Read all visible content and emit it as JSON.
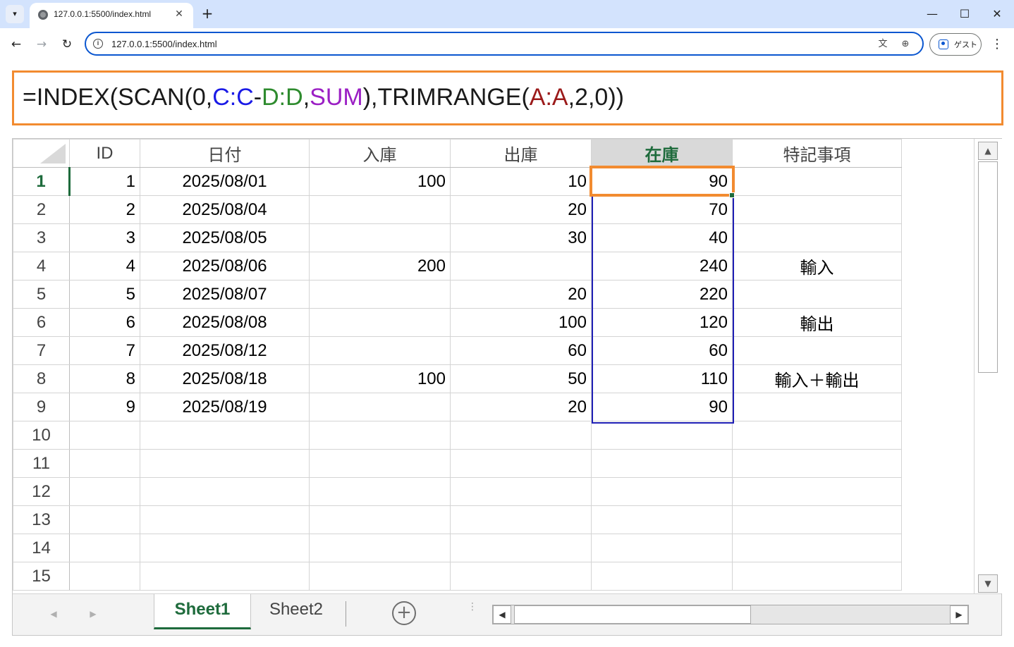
{
  "browser": {
    "tab_title": "127.0.0.1:5500/index.html",
    "url": "127.0.0.1:5500/index.html",
    "profile_label": "ゲスト",
    "icons": {
      "tab_list": "▾",
      "close": "✕",
      "new_tab": "+",
      "minimize": "—",
      "maximize": "☐",
      "window_close": "✕",
      "back": "←",
      "forward": "→",
      "reload": "↻",
      "info": "i",
      "translate": "文",
      "zoom": "⊕",
      "menu": "⋮"
    }
  },
  "formula": {
    "p1": "=INDEX(SCAN(0,",
    "ref_c": "C:C",
    "minus": "-",
    "ref_d": "D:D",
    "comma": ",",
    "sum": "SUM",
    "p2": "),TRIMRANGE(",
    "ref_a": "A:A",
    "p3": ",2,0))"
  },
  "sheet": {
    "headers": [
      "ID",
      "日付",
      "入庫",
      "出庫",
      "在庫",
      "特記事項"
    ],
    "active_column_index": 4,
    "active_row_number": "1",
    "rows": [
      {
        "num": "1",
        "cells": [
          "1",
          "2025/08/01",
          "100",
          "10",
          "90",
          ""
        ]
      },
      {
        "num": "2",
        "cells": [
          "2",
          "2025/08/04",
          "",
          "20",
          "70",
          ""
        ]
      },
      {
        "num": "3",
        "cells": [
          "3",
          "2025/08/05",
          "",
          "30",
          "40",
          ""
        ]
      },
      {
        "num": "4",
        "cells": [
          "4",
          "2025/08/06",
          "200",
          "",
          "240",
          "輸入"
        ]
      },
      {
        "num": "5",
        "cells": [
          "5",
          "2025/08/07",
          "",
          "20",
          "220",
          ""
        ]
      },
      {
        "num": "6",
        "cells": [
          "6",
          "2025/08/08",
          "",
          "100",
          "120",
          "輸出"
        ]
      },
      {
        "num": "7",
        "cells": [
          "7",
          "2025/08/12",
          "",
          "60",
          "60",
          ""
        ]
      },
      {
        "num": "8",
        "cells": [
          "8",
          "2025/08/18",
          "100",
          "50",
          "110",
          "輸入＋輸出"
        ]
      },
      {
        "num": "9",
        "cells": [
          "9",
          "2025/08/19",
          "",
          "20",
          "90",
          ""
        ]
      },
      {
        "num": "10",
        "cells": [
          "",
          "",
          "",
          "",
          "",
          ""
        ]
      },
      {
        "num": "11",
        "cells": [
          "",
          "",
          "",
          "",
          "",
          ""
        ]
      },
      {
        "num": "12",
        "cells": [
          "",
          "",
          "",
          "",
          "",
          ""
        ]
      },
      {
        "num": "13",
        "cells": [
          "",
          "",
          "",
          "",
          "",
          ""
        ]
      },
      {
        "num": "14",
        "cells": [
          "",
          "",
          "",
          "",
          "",
          ""
        ]
      },
      {
        "num": "15",
        "cells": [
          "",
          "",
          "",
          "",
          "",
          ""
        ]
      }
    ],
    "tabs": [
      "Sheet1",
      "Sheet2"
    ],
    "active_tab": "Sheet1",
    "icons": {
      "scroll_up": "▲",
      "scroll_down": "▼",
      "scroll_left": "◀",
      "scroll_right": "▶",
      "tab_prev": "◀",
      "tab_next": "▶",
      "add_sheet": "+",
      "more": "⋮"
    }
  },
  "colors": {
    "accent_orange": "#f28b30",
    "excel_green": "#1e6b3c",
    "ref_blue": "#1a1ae6",
    "ref_green": "#2e8b2e",
    "ref_purple": "#9b1fc4",
    "ref_red": "#9b1a1a",
    "browser_frame": "#d3e3fd"
  }
}
